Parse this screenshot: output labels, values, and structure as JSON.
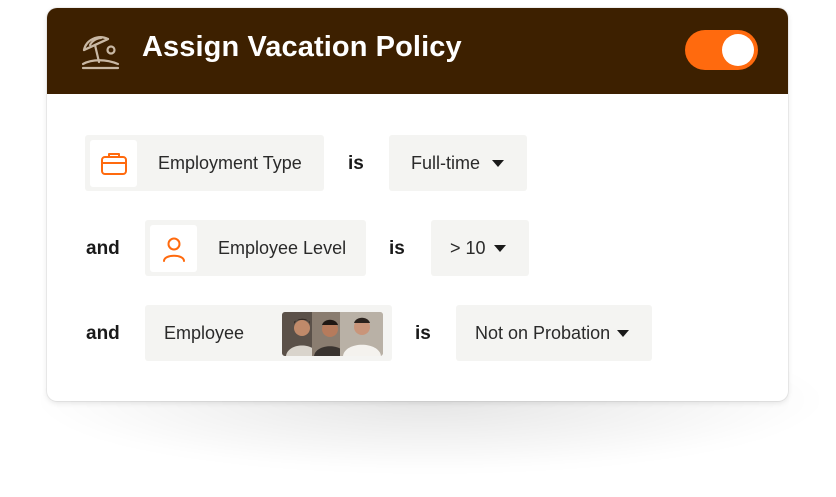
{
  "header": {
    "title": "Assign Vacation Policy",
    "icon": "beach-umbrella-icon",
    "toggle": {
      "state": "on",
      "color": "#ff6a0e"
    },
    "background": "#3d2000"
  },
  "rules": [
    {
      "connector": "",
      "field_label": "Employment Type",
      "field_icon": "briefcase-icon",
      "operator": "is",
      "value": "Full-time"
    },
    {
      "connector": "and",
      "field_label": "Employee Level",
      "field_icon": "person-icon",
      "operator": "is",
      "value": "> 10"
    },
    {
      "connector": "and",
      "field_label": "Employee",
      "field_icon": "employee-avatars",
      "operator": "is",
      "value": "Not on Probation"
    }
  ],
  "colors": {
    "accent": "#ff6a0e"
  }
}
